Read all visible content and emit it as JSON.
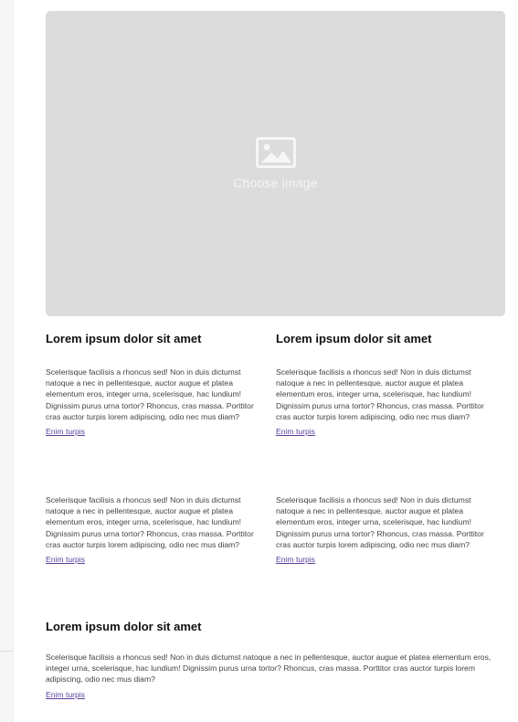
{
  "image_picker": {
    "label": "Choose image",
    "icon": "image-icon"
  },
  "columns": [
    {
      "title": "Lorem ipsum dolor sit amet",
      "items": [
        {
          "text": "Scelerisque facilisis a rhoncus sed! Non in duis dictumst natoque a nec in pellentesque, auctor augue et platea elementum eros, integer urna, scelerisque, hac lundium! Dignissim purus urna tortor? Rhoncus, cras massa. Porttitor cras auctor turpis lorem adipiscing, odio nec mus diam?",
          "link": "Enim turpis"
        },
        {
          "text": "Scelerisque facilisis a rhoncus sed! Non in duis dictumst natoque a nec in pellentesque, auctor augue et platea elementum eros, integer urna, scelerisque, hac lundium! Dignissim purus urna tortor? Rhoncus, cras massa. Porttitor cras auctor turpis lorem adipiscing, odio nec mus diam?",
          "link": "Enim turpis"
        }
      ]
    },
    {
      "title": "Lorem ipsum dolor sit amet",
      "items": [
        {
          "text": "Scelerisque facilisis a rhoncus sed! Non in duis dictumst natoque a nec in pellentesque, auctor augue et platea elementum eros, integer urna, scelerisque, hac lundium! Dignissim purus urna tortor? Rhoncus, cras massa. Porttitor cras auctor turpis lorem adipiscing, odio nec mus diam?",
          "link": "Enim turpis"
        },
        {
          "text": "Scelerisque facilisis a rhoncus sed! Non in duis dictumst natoque a nec in pellentesque, auctor augue et platea elementum eros, integer urna, scelerisque, hac lundium! Dignissim purus urna tortor? Rhoncus, cras massa. Porttitor cras auctor turpis lorem adipiscing, odio nec mus diam?",
          "link": "Enim turpis"
        }
      ]
    }
  ],
  "full_section": {
    "title": "Lorem ipsum dolor sit amet",
    "text": "Scelerisque facilisis a rhoncus sed! Non in duis dictumst natoque a nec in pellentesque, auctor augue et platea elementum eros, integer urna, scelerisque, hac lundium! Dignissim purus urna tortor? Rhoncus, cras massa. Porttitor cras auctor turpis lorem adipiscing, odio nec mus diam?",
    "link": "Enim turpis"
  },
  "colors": {
    "placeholder_bg": "#dcdcdc",
    "link": "#5b3f9c",
    "heading": "#111111",
    "body_text": "#444444"
  }
}
